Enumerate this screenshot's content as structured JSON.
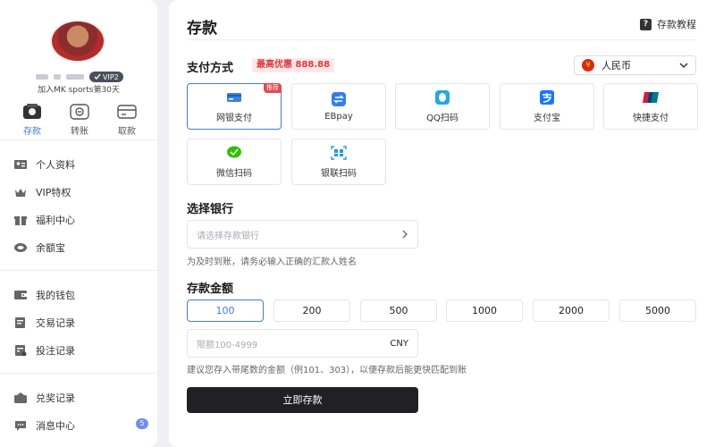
{
  "sidebar": {
    "vip_badge": "VIP2",
    "join_text": "加入MK sports第30天",
    "quick": [
      {
        "label": "存款",
        "icon": "deposit-icon",
        "active": true
      },
      {
        "label": "转账",
        "icon": "transfer-icon"
      },
      {
        "label": "取款",
        "icon": "withdraw-icon"
      }
    ],
    "menu": [
      {
        "label": "个人资料",
        "icon": "profile-icon"
      },
      {
        "label": "VIP特权",
        "icon": "crown-icon"
      },
      {
        "label": "福利中心",
        "icon": "gift-icon"
      },
      {
        "label": "余额宝",
        "icon": "coin-icon"
      },
      {
        "label": "我的钱包",
        "icon": "wallet-icon"
      },
      {
        "label": "交易记录",
        "icon": "transaction-icon"
      },
      {
        "label": "投注记录",
        "icon": "bet-record-icon"
      },
      {
        "label": "兑奖记录",
        "icon": "redeem-icon"
      },
      {
        "label": "消息中心",
        "icon": "message-icon",
        "badge": "5"
      }
    ]
  },
  "main": {
    "title": "存款",
    "tutorial": "存款教程",
    "payment": {
      "label": "支付方式",
      "promo": "最高优惠 888.88",
      "currency": "人民币",
      "currency_symbol": "¥",
      "methods": [
        {
          "label": "网银支付",
          "icon": "bank-card-icon",
          "tag": "推荐",
          "active": true
        },
        {
          "label": "EBpay",
          "icon": "ebpay-icon"
        },
        {
          "label": "QQ扫码",
          "icon": "qq-icon"
        },
        {
          "label": "支付宝",
          "icon": "alipay-icon"
        },
        {
          "label": "快捷支付",
          "icon": "unionpay-icon"
        },
        {
          "label": "微信扫码",
          "icon": "wechat-icon"
        },
        {
          "label": "银联扫码",
          "icon": "qr-scan-icon"
        }
      ]
    },
    "bank": {
      "label": "选择银行",
      "placeholder": "请选择存款银行",
      "hint": "为及时到账，请务必输入正确的汇款人姓名"
    },
    "amount": {
      "label": "存款金额",
      "options": [
        "100",
        "200",
        "500",
        "1000",
        "2000",
        "5000"
      ],
      "selected": "100",
      "placeholder": "限额100-4999",
      "unit": "CNY",
      "hint": "建议您存入带尾数的金额（例101、303），以便存款后能更快匹配到账"
    },
    "submit_label": "立即存款"
  },
  "colors": {
    "accent": "#3b7fe0",
    "promo": "#e0393e",
    "button": "#1f2125"
  }
}
